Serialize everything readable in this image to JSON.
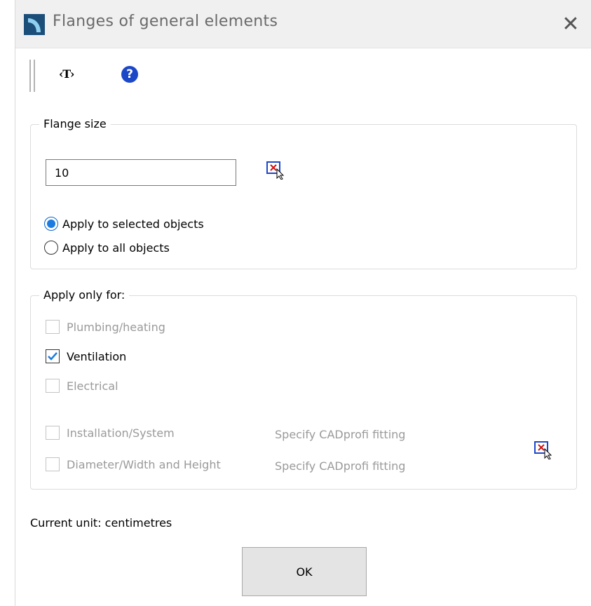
{
  "window": {
    "title": "Flanges of general elements",
    "close_symbol": "✕",
    "title_icon": "app-logo-icon"
  },
  "toolbar": {
    "text_tool_label": "‹T›",
    "help_symbol": "?"
  },
  "flange_size": {
    "legend": "Flange size",
    "value": "10",
    "options": [
      {
        "label": "Apply to selected objects",
        "selected": true
      },
      {
        "label": "Apply to all objects",
        "selected": false
      }
    ]
  },
  "apply_only": {
    "legend": "Apply only for:",
    "categories": [
      {
        "label": "Plumbing/heating",
        "checked": false,
        "enabled": false
      },
      {
        "label": "Ventilation",
        "checked": true,
        "enabled": true
      },
      {
        "label": "Electrical",
        "checked": false,
        "enabled": false
      }
    ],
    "filters": [
      {
        "label": "Installation/System",
        "checked": false,
        "enabled": false,
        "fitting": "Specify CADprofi fitting"
      },
      {
        "label": "Diameter/Width and Height",
        "checked": false,
        "enabled": false,
        "fitting": "Specify CADprofi fitting"
      }
    ]
  },
  "footer": {
    "unit_text": "Current unit: centimetres",
    "ok_label": "OK"
  },
  "colors": {
    "accent": "#1c7be0",
    "help": "#1c48c8",
    "disabled_text": "#9a9a9a"
  }
}
